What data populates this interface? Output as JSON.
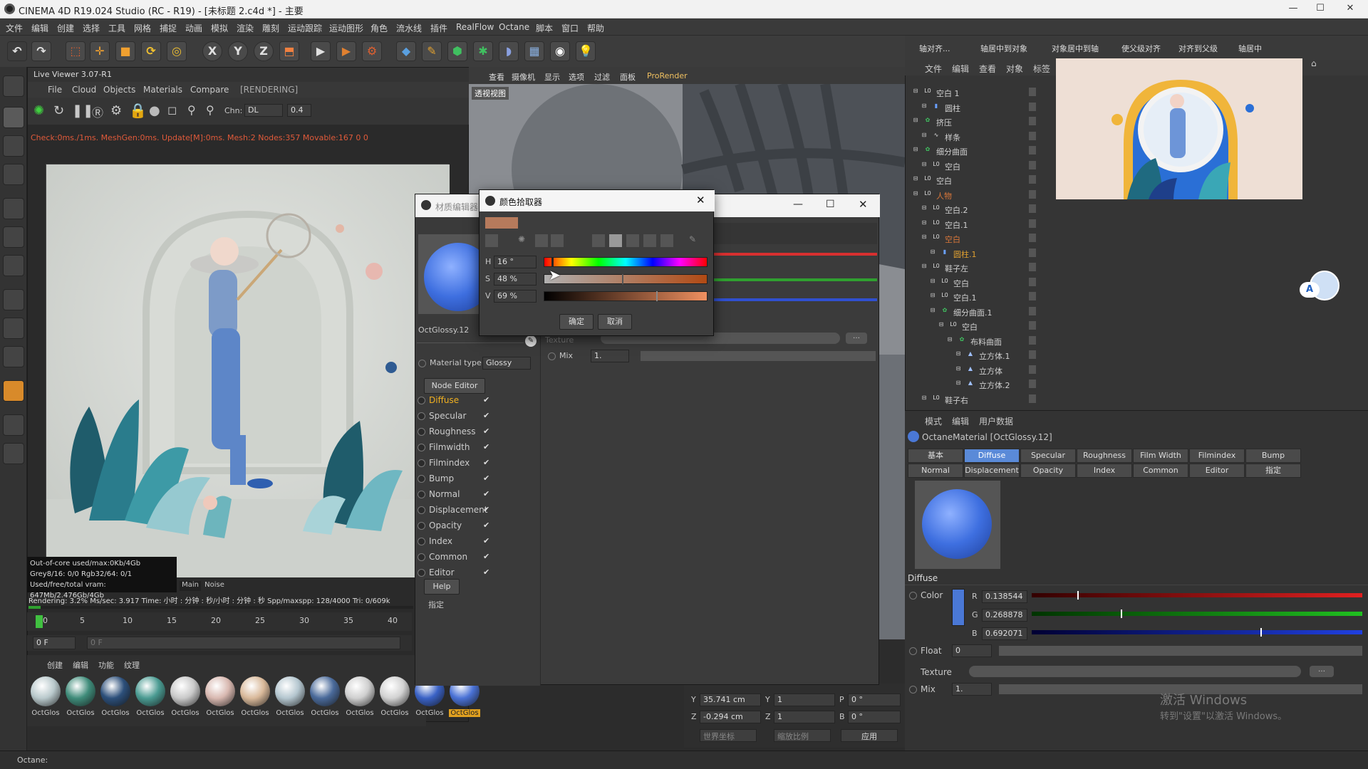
{
  "window": {
    "title": "CINEMA 4D R19.024 Studio (RC - R19) - [未标题 2.c4d *] - 主要",
    "controls": [
      "—",
      "☐",
      "✕"
    ]
  },
  "menubar": [
    "文件",
    "编辑",
    "创建",
    "选择",
    "工具",
    "网格",
    "捕捉",
    "动画",
    "模拟",
    "渲染",
    "雕刻",
    "运动跟踪",
    "运动图形",
    "角色",
    "流水线",
    "插件",
    "RealFlow",
    "Octane",
    "脚本",
    "窗口",
    "帮助"
  ],
  "toolbar": {
    "x_label": "X",
    "y_label": "Y",
    "z_label": "Z"
  },
  "live_viewer": {
    "title": "Live Viewer 3.07-R1",
    "menu": [
      "File",
      "Cloud",
      "Objects",
      "Materials",
      "Compare"
    ],
    "status": "[RENDERING]",
    "chn_label": "Chn:",
    "chn_value": "DL",
    "value_field": "0.4",
    "check_line": "Check:0ms./1ms. MeshGen:0ms. Update[M]:0ms. Mesh:2 Nodes:357 Movable:167  0 0",
    "stats": [
      "Out-of-core used/max:0Kb/4Gb",
      "Grey8/16: 0/0        Rgb32/64: 0/1",
      "Used/free/total vram: 647Mb/2.476Gb/4Gb"
    ],
    "tabs": [
      "Main",
      "Noise"
    ],
    "render_line": "Rendering: 3.2%   Ms/sec: 3.917   Time: 小时 : 分钟 : 秒/小时 : 分钟 : 秒   Spp/maxspp: 128/4000   Tri: 0/609k",
    "progress_fraction": 0.032
  },
  "timeline": {
    "ticks": [
      "0",
      "5",
      "10",
      "15",
      "20",
      "25",
      "30",
      "35",
      "40"
    ],
    "current_frame": "0 F",
    "frame_field": "0 F"
  },
  "material_manager": {
    "tabs": [
      "创建",
      "编辑",
      "功能",
      "纹理"
    ],
    "materials": [
      {
        "label": "OctGlos",
        "color": "#b9c9cc"
      },
      {
        "label": "OctGlos",
        "color": "#3f8c7a"
      },
      {
        "label": "OctGlos",
        "color": "#2c4f7a"
      },
      {
        "label": "OctGlos",
        "color": "#4a9b92"
      },
      {
        "label": "OctGlos",
        "color": "#c9c9c9"
      },
      {
        "label": "OctGlos",
        "color": "#d8b8b0"
      },
      {
        "label": "OctGlos",
        "color": "#d9b99a"
      },
      {
        "label": "OctGlos",
        "color": "#b4c6cf"
      },
      {
        "label": "OctGlos",
        "color": "#4a6a9a"
      },
      {
        "label": "OctGlos",
        "color": "#cfcfcf"
      },
      {
        "label": "OctGlos",
        "color": "#d2d2d2"
      },
      {
        "label": "OctGlos",
        "color": "#3a62c6"
      },
      {
        "label": "OctGlos",
        "color": "#4a72d6",
        "selected": true
      }
    ]
  },
  "viewport": {
    "menu": [
      "查看",
      "摄像机",
      "显示",
      "选项",
      "过滤",
      "面板",
      "ProRender"
    ],
    "label": "透视视图"
  },
  "coordinates": {
    "rows": [
      {
        "axis": "Y",
        "pos": "35.741 cm",
        "saxis": "Y",
        "scale": "1",
        "raxis": "P",
        "rot": "0 °"
      },
      {
        "axis": "Z",
        "pos": "-0.294 cm",
        "saxis": "Z",
        "scale": "1",
        "raxis": "B",
        "rot": "0 °"
      }
    ],
    "mode1": "世界坐标",
    "mode2": "缩放比例",
    "apply": "应用"
  },
  "material_editor": {
    "title": "材质编辑器",
    "material_name": "OctGlossy.12",
    "material_type_label": "Material type",
    "material_type_value": "Glossy",
    "node_editor": "Node Editor",
    "channels": [
      "Diffuse",
      "Specular",
      "Roughness",
      "Filmwidth",
      "Filmindex",
      "Bump",
      "Normal",
      "Displacement",
      "Opacity",
      "Index",
      "Common",
      "Editor"
    ],
    "active_channel": "Diffuse",
    "help": "Help",
    "assign": "指定",
    "texture_label": "Texture",
    "mix_label": "Mix",
    "mix_value": "1."
  },
  "color_picker": {
    "title": "颜色拾取器",
    "swatch": "#b67a5c",
    "h_label": "H",
    "h_value": "16 °",
    "s_label": "S",
    "s_value": "48 %",
    "v_label": "V",
    "v_value": "69 %",
    "h_fraction": 0.044,
    "s_fraction": 0.48,
    "v_fraction": 0.69,
    "ok": "确定",
    "cancel": "取消"
  },
  "object_manager": {
    "toolbar": [
      "轴对齐...",
      "轴居中到对象",
      "对象居中到轴",
      "使父级对齐",
      "对齐到父级",
      "轴居中"
    ],
    "menu": [
      "文件",
      "编辑",
      "查看",
      "对象",
      "标签"
    ],
    "items": [
      {
        "name": "空白 1",
        "depth": 0,
        "kind": "null"
      },
      {
        "name": "圆柱",
        "depth": 1,
        "kind": "cyl"
      },
      {
        "name": "挤压",
        "depth": 0,
        "kind": "gen"
      },
      {
        "name": "样条",
        "depth": 1,
        "kind": "spline"
      },
      {
        "name": "细分曲面",
        "depth": 0,
        "kind": "gen"
      },
      {
        "name": "空白",
        "depth": 1,
        "kind": "null"
      },
      {
        "name": "空白",
        "depth": 0,
        "kind": "null"
      },
      {
        "name": "人物",
        "depth": 0,
        "kind": "null",
        "color": "#d9773a"
      },
      {
        "name": "空白.2",
        "depth": 1,
        "kind": "null"
      },
      {
        "name": "空白.1",
        "depth": 1,
        "kind": "null"
      },
      {
        "name": "空白",
        "depth": 1,
        "kind": "null",
        "color": "#d9773a"
      },
      {
        "name": "圆柱.1",
        "depth": 2,
        "kind": "cyl",
        "color": "#e0a030"
      },
      {
        "name": "鞋子左",
        "depth": 1,
        "kind": "null"
      },
      {
        "name": "空白",
        "depth": 2,
        "kind": "null"
      },
      {
        "name": "空白.1",
        "depth": 2,
        "kind": "null"
      },
      {
        "name": "细分曲面.1",
        "depth": 2,
        "kind": "gen"
      },
      {
        "name": "空白",
        "depth": 3,
        "kind": "null"
      },
      {
        "name": "布料曲面",
        "depth": 4,
        "kind": "gen"
      },
      {
        "name": "立方体.1",
        "depth": 5,
        "kind": "cube"
      },
      {
        "name": "立方体",
        "depth": 5,
        "kind": "cube"
      },
      {
        "name": "立方体.2",
        "depth": 5,
        "kind": "cube"
      },
      {
        "name": "鞋子右",
        "depth": 1,
        "kind": "null"
      }
    ]
  },
  "attributes": {
    "menu": [
      "模式",
      "编辑",
      "用户数据"
    ],
    "header": "OctaneMaterial [OctGlossy.12]",
    "tabs_row1": [
      "基本",
      "Diffuse",
      "Specular",
      "Roughness",
      "Film Width",
      "Filmindex",
      "Bump"
    ],
    "tabs_row2": [
      "Normal",
      "Displacement",
      "Opacity",
      "Index",
      "Common",
      "Editor",
      "指定"
    ],
    "active_tab": "Diffuse",
    "section": "Diffuse",
    "color_label": "Color",
    "r_label": "R",
    "r_value": "0.138544",
    "g_label": "G",
    "g_value": "0.268878",
    "b_label": "B",
    "b_value": "0.692071",
    "r_fraction": 0.138544,
    "g_fraction": 0.268878,
    "b_fraction": 0.692071,
    "float_label": "Float",
    "float_value": "0",
    "texture_label": "Texture",
    "mix_label": "Mix",
    "mix_value": "1.",
    "swatch": "#4a78d6"
  },
  "watermark": {
    "line1": "激活 Windows",
    "line2": "转到\"设置\"以激活 Windows。"
  },
  "statusbar": {
    "text": "Octane:"
  }
}
